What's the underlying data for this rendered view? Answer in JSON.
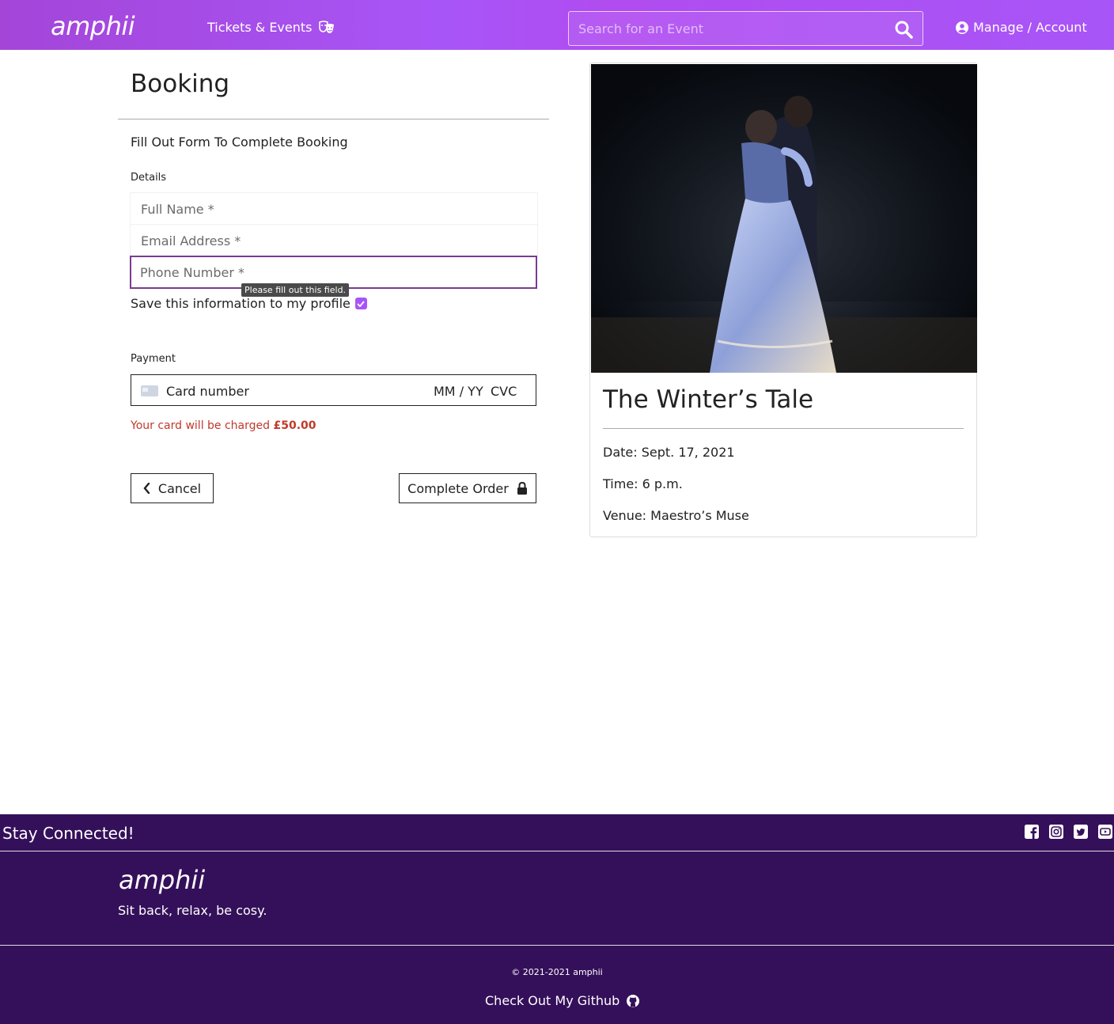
{
  "colors": {
    "nav_purple": "#a855f7",
    "footer_purple": "#35105a",
    "charge_red": "#c0392b",
    "focus_border": "#7a3c8f"
  },
  "nav": {
    "brand": "amphii",
    "events_label": "Tickets & Events",
    "events_icon": "theater-masks-icon",
    "search_placeholder": "Search for an Event",
    "search_icon": "search-icon",
    "account_label": "Manage / Account",
    "account_icon": "user-circle-icon"
  },
  "booking": {
    "title": "Booking",
    "intro": "Fill Out Form To Complete Booking",
    "details_label": "Details",
    "fields": {
      "full_name": "Full Name *",
      "email": "Email Address *",
      "phone": "Phone Number *"
    },
    "tooltip": "Please fill out this field.",
    "save_label": "Save this information to my profile",
    "save_checked": true,
    "payment_label": "Payment",
    "card": {
      "number": "Card number",
      "expiry": "MM / YY",
      "cvc": "CVC"
    },
    "charge_text": "Your card will be charged ",
    "charge_amount": "£50.00",
    "cancel_label": "Cancel",
    "complete_label": "Complete Order"
  },
  "event": {
    "title": "The Winter’s Tale",
    "date": "Date: Sept. 17, 2021",
    "time": "Time: 6 p.m.",
    "venue": "Venue: Maestro’s Muse"
  },
  "footer": {
    "stay_connected": "Stay Connected!",
    "social_icons": [
      "facebook-icon",
      "instagram-icon",
      "twitter-icon",
      "youtube-icon"
    ],
    "brand": "amphii",
    "tagline": "Sit back, relax, be cosy.",
    "copyright": "© 2021-2021 amphii",
    "github_label": "Check Out My Github"
  }
}
